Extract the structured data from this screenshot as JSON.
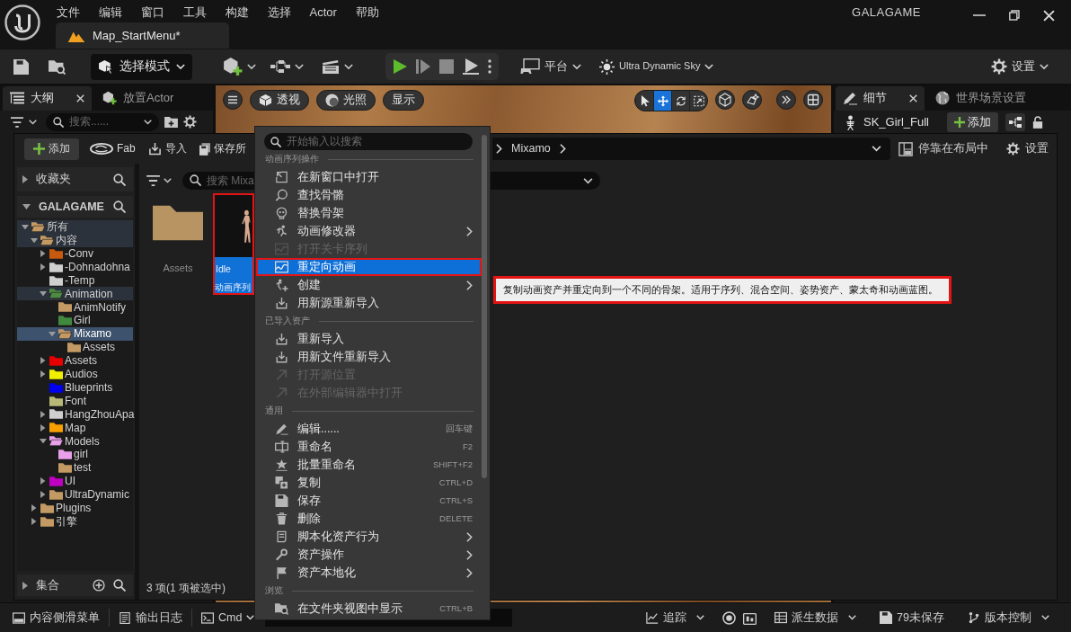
{
  "title_bar": {
    "menus": [
      "文件",
      "编辑",
      "窗口",
      "工具",
      "构建",
      "选择",
      "Actor",
      "帮助"
    ],
    "document_tab": {
      "label": "Map_StartMenu*",
      "selected": true
    },
    "project_name": "GALAGAME"
  },
  "main_toolbar": {
    "mode_dropdown": "选择模式",
    "platform_dropdown": "平台",
    "sky_dropdown": "Ultra Dynamic Sky",
    "settings_dropdown": "设置"
  },
  "outliner": {
    "tabs": [
      {
        "label": "大纲",
        "selected": true,
        "closable": true
      },
      {
        "label": "放置Actor",
        "selected": false,
        "closable": false
      }
    ],
    "search": {
      "placeholder": "搜索......"
    }
  },
  "viewport": {
    "buttons": [
      "透视",
      "光照",
      "显示"
    ],
    "transform_tools": [
      {
        "selected": false
      },
      {
        "selected": true
      },
      {
        "selected": false
      },
      {
        "selected": false
      }
    ]
  },
  "details": {
    "tabs": [
      {
        "label": "细节",
        "selected": true,
        "closable": true
      },
      {
        "label": "世界场景设置",
        "selected": false,
        "closable": false
      }
    ],
    "actor_name": "SK_Girl_Full",
    "add_button": "添加"
  },
  "content_browser": {
    "toolbar": {
      "add_button": "添加",
      "fab_button": "Fab",
      "import_button": "导入",
      "save_button": "保存所"
    },
    "path": [
      "Mixamo"
    ],
    "dock_button": "停靠在布局中",
    "settings_button": "设置",
    "favorites": {
      "label": "收藏夹",
      "expanded": false
    },
    "project": {
      "label": "GALAGAME",
      "expanded": true
    },
    "tree": [
      {
        "label": "所有",
        "color": "#c49a64",
        "expandable": true,
        "expanded": true,
        "selected": false,
        "in_path": true,
        "children": [
          {
            "label": "内容",
            "color": "#c49a64",
            "expandable": true,
            "expanded": true,
            "selected": false,
            "in_path": true,
            "children": [
              {
                "label": "-Conv",
                "color": "#c85a10",
                "expandable": true,
                "expanded": false,
                "selected": false,
                "in_path": false
              },
              {
                "label": "-Dohnadohna",
                "color": "#cfcfcf",
                "expandable": true,
                "expanded": false,
                "selected": false,
                "in_path": false
              },
              {
                "label": "-Temp",
                "color": "#cfcfcf",
                "expandable": false,
                "expanded": false,
                "selected": false,
                "in_path": false
              },
              {
                "label": "Animation",
                "color": "#4f8a45",
                "expandable": true,
                "expanded": true,
                "selected": false,
                "in_path": true,
                "children": [
                  {
                    "label": "AnimNotify",
                    "color": "#c49a64",
                    "expandable": false,
                    "expanded": false,
                    "selected": false,
                    "in_path": false
                  },
                  {
                    "label": "Girl",
                    "color": "#3f8a3f",
                    "expandable": false,
                    "expanded": false,
                    "selected": false,
                    "in_path": false
                  },
                  {
                    "label": "Mixamo",
                    "color": "#c49a64",
                    "expandable": true,
                    "expanded": true,
                    "selected": true,
                    "in_path": true,
                    "children": [
                      {
                        "label": "Assets",
                        "color": "#c49a64",
                        "expandable": false,
                        "expanded": false,
                        "selected": false,
                        "in_path": false
                      }
                    ]
                  }
                ]
              },
              {
                "label": "Assets",
                "color": "#e80000",
                "expandable": true,
                "expanded": false,
                "selected": false,
                "in_path": false
              },
              {
                "label": "Audios",
                "color": "#f0f000",
                "expandable": true,
                "expanded": false,
                "selected": false,
                "in_path": false
              },
              {
                "label": "Blueprints",
                "color": "#0000f0",
                "expandable": false,
                "expanded": false,
                "selected": false,
                "in_path": false
              },
              {
                "label": "Font",
                "color": "#b8b878",
                "expandable": false,
                "expanded": false,
                "selected": false,
                "in_path": false
              },
              {
                "label": "HangZhouApa",
                "color": "#cfcfcf",
                "expandable": true,
                "expanded": false,
                "selected": false,
                "in_path": false
              },
              {
                "label": "Map",
                "color": "#f7a000",
                "expandable": true,
                "expanded": false,
                "selected": false,
                "in_path": false
              },
              {
                "label": "Models",
                "color": "#e8a0e8",
                "expandable": true,
                "expanded": true,
                "selected": false,
                "in_path": false,
                "children": [
                  {
                    "label": "girl",
                    "color": "#e8a0e8",
                    "expandable": false,
                    "expanded": false,
                    "selected": false,
                    "in_path": false
                  },
                  {
                    "label": "test",
                    "color": "#c49a64",
                    "expandable": false,
                    "expanded": false,
                    "selected": false,
                    "in_path": false
                  }
                ]
              },
              {
                "label": "UI",
                "color": "#c000c0",
                "expandable": true,
                "expanded": false,
                "selected": false,
                "in_path": false
              },
              {
                "label": "UltraDynamic",
                "color": "#c49a64",
                "expandable": true,
                "expanded": false,
                "selected": false,
                "in_path": false
              }
            ]
          },
          {
            "label": "Plugins",
            "color": "#c49a64",
            "expandable": true,
            "expanded": false,
            "selected": false,
            "in_path": false
          },
          {
            "label": "引擎",
            "color": "#c49a64",
            "expandable": true,
            "expanded": false,
            "selected": false,
            "in_path": false
          }
        ]
      }
    ],
    "collections": {
      "label": "集合",
      "expanded": false
    },
    "search": {
      "placeholder": "搜索 Mixa"
    },
    "assets": [
      {
        "kind": "folder",
        "name": "Assets",
        "selected": false,
        "highlighted": false
      },
      {
        "kind": "animation",
        "name": "Idle",
        "type_label": "动画序列",
        "selected": true,
        "highlighted": true
      }
    ],
    "item_count": "3 项(1 项被选中)"
  },
  "context_menu": {
    "search": {
      "placeholder": "开始输入以搜索"
    },
    "sections": [
      {
        "header": "动画序列操作",
        "items": [
          {
            "label": "在新窗口中打开",
            "submenu": false,
            "disabled": false,
            "selected": false,
            "highlighted": false
          },
          {
            "label": "查找骨骼",
            "submenu": false,
            "disabled": false,
            "selected": false,
            "highlighted": false
          },
          {
            "label": "替换骨架",
            "submenu": false,
            "disabled": false,
            "selected": false,
            "highlighted": false
          },
          {
            "label": "动画修改器",
            "submenu": true,
            "disabled": false,
            "selected": false,
            "highlighted": false
          },
          {
            "label": "打开关卡序列",
            "submenu": false,
            "disabled": true,
            "selected": false,
            "highlighted": false
          },
          {
            "label": "重定向动画",
            "submenu": false,
            "disabled": false,
            "selected": true,
            "highlighted": true
          },
          {
            "label": "创建",
            "submenu": true,
            "disabled": false,
            "selected": false,
            "highlighted": false
          },
          {
            "label": "用新源重新导入",
            "submenu": false,
            "disabled": false,
            "selected": false,
            "highlighted": false
          }
        ]
      },
      {
        "header": "已导入资产",
        "items": [
          {
            "label": "重新导入",
            "submenu": false,
            "disabled": false,
            "selected": false,
            "highlighted": false
          },
          {
            "label": "用新文件重新导入",
            "submenu": false,
            "disabled": false,
            "selected": false,
            "highlighted": false
          },
          {
            "label": "打开源位置",
            "submenu": false,
            "disabled": true,
            "selected": false,
            "highlighted": false
          },
          {
            "label": "在外部编辑器中打开",
            "submenu": false,
            "disabled": true,
            "selected": false,
            "highlighted": false
          }
        ]
      },
      {
        "header": "通用",
        "items": [
          {
            "label": "编辑......",
            "shortcut": "回车键",
            "submenu": false,
            "disabled": false,
            "selected": false,
            "highlighted": false
          },
          {
            "label": "重命名",
            "shortcut": "F2",
            "submenu": false,
            "disabled": false,
            "selected": false,
            "highlighted": false
          },
          {
            "label": "批量重命名",
            "shortcut": "SHIFT+F2",
            "submenu": false,
            "disabled": false,
            "selected": false,
            "highlighted": false
          },
          {
            "label": "复制",
            "shortcut": "CTRL+D",
            "submenu": false,
            "disabled": false,
            "selected": false,
            "highlighted": false
          },
          {
            "label": "保存",
            "shortcut": "CTRL+S",
            "submenu": false,
            "disabled": false,
            "selected": false,
            "highlighted": false
          },
          {
            "label": "删除",
            "shortcut": "DELETE",
            "submenu": false,
            "disabled": false,
            "selected": false,
            "highlighted": false
          },
          {
            "label": "脚本化资产行为",
            "submenu": true,
            "disabled": false,
            "selected": false,
            "highlighted": false
          },
          {
            "label": "资产操作",
            "submenu": true,
            "disabled": false,
            "selected": false,
            "highlighted": false
          },
          {
            "label": "资产本地化",
            "submenu": true,
            "disabled": false,
            "selected": false,
            "highlighted": false
          }
        ]
      },
      {
        "header": "浏览",
        "items": [
          {
            "label": "在文件夹视图中显示",
            "shortcut": "CTRL+B",
            "submenu": false,
            "disabled": false,
            "selected": false,
            "highlighted": false
          }
        ]
      }
    ]
  },
  "tooltip": {
    "text": "复制动画资产并重定向到一个不同的骨架。适用于序列、混合空间、姿势资产、蒙太奇和动画蓝图。",
    "highlighted": true
  },
  "status_bar": {
    "left": [
      {
        "label": "内容侧滑菜单",
        "dropdown": false
      },
      {
        "label": "输出日志",
        "dropdown": false
      },
      {
        "label": "Cmd",
        "dropdown": true
      }
    ],
    "right": [
      {
        "label": "追踪",
        "dropdown": true
      },
      {
        "label": "派生数据",
        "dropdown": true
      },
      {
        "label": "79未保存",
        "dropdown": false
      },
      {
        "label": "版本控制",
        "dropdown": true
      }
    ]
  }
}
